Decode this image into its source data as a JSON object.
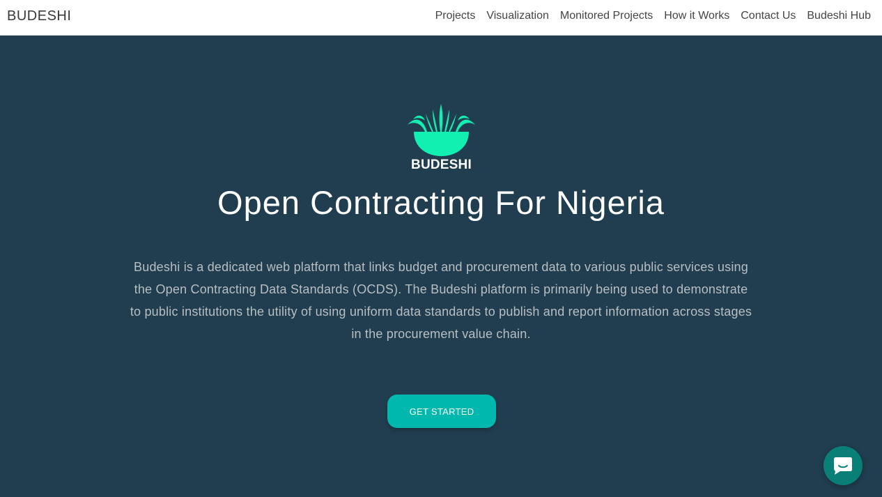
{
  "navbar": {
    "brand": "BUDESHI",
    "links": [
      {
        "label": "Projects"
      },
      {
        "label": "Visualization"
      },
      {
        "label": "Monitored Projects"
      },
      {
        "label": "How it Works"
      },
      {
        "label": "Contact Us"
      },
      {
        "label": "Budeshi Hub"
      }
    ]
  },
  "hero": {
    "logo_text": "BUDESHI",
    "title": "Open Contracting For Nigeria",
    "description": "Budeshi is a dedicated web platform that links budget and procurement data to various public services using the Open Contracting Data Standards (OCDS). The Budeshi platform is primarily being used to demonstrate to public institutions the utility of using uniform data standards to publish and report information across stages in the procurement value chain.",
    "cta_label": "GET STARTED"
  },
  "chat": {
    "icon": "chat-bubble-icon"
  },
  "colors": {
    "hero_background": "#203e4f",
    "accent": "#00b8ad",
    "logo_green": "#11f0b0",
    "chat_button": "#0a7f77"
  }
}
